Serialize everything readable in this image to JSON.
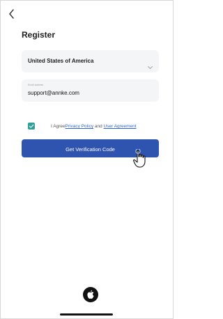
{
  "header": {
    "title": "Register"
  },
  "country": {
    "value": "United States of America"
  },
  "email": {
    "label": "Email address",
    "value": "support@annke.com"
  },
  "agreement": {
    "prefix": "I Agree",
    "link1": "Privacy Policy",
    "middle": " and ",
    "link2": "User Agreement"
  },
  "button": {
    "label": "Get Verification Code"
  }
}
